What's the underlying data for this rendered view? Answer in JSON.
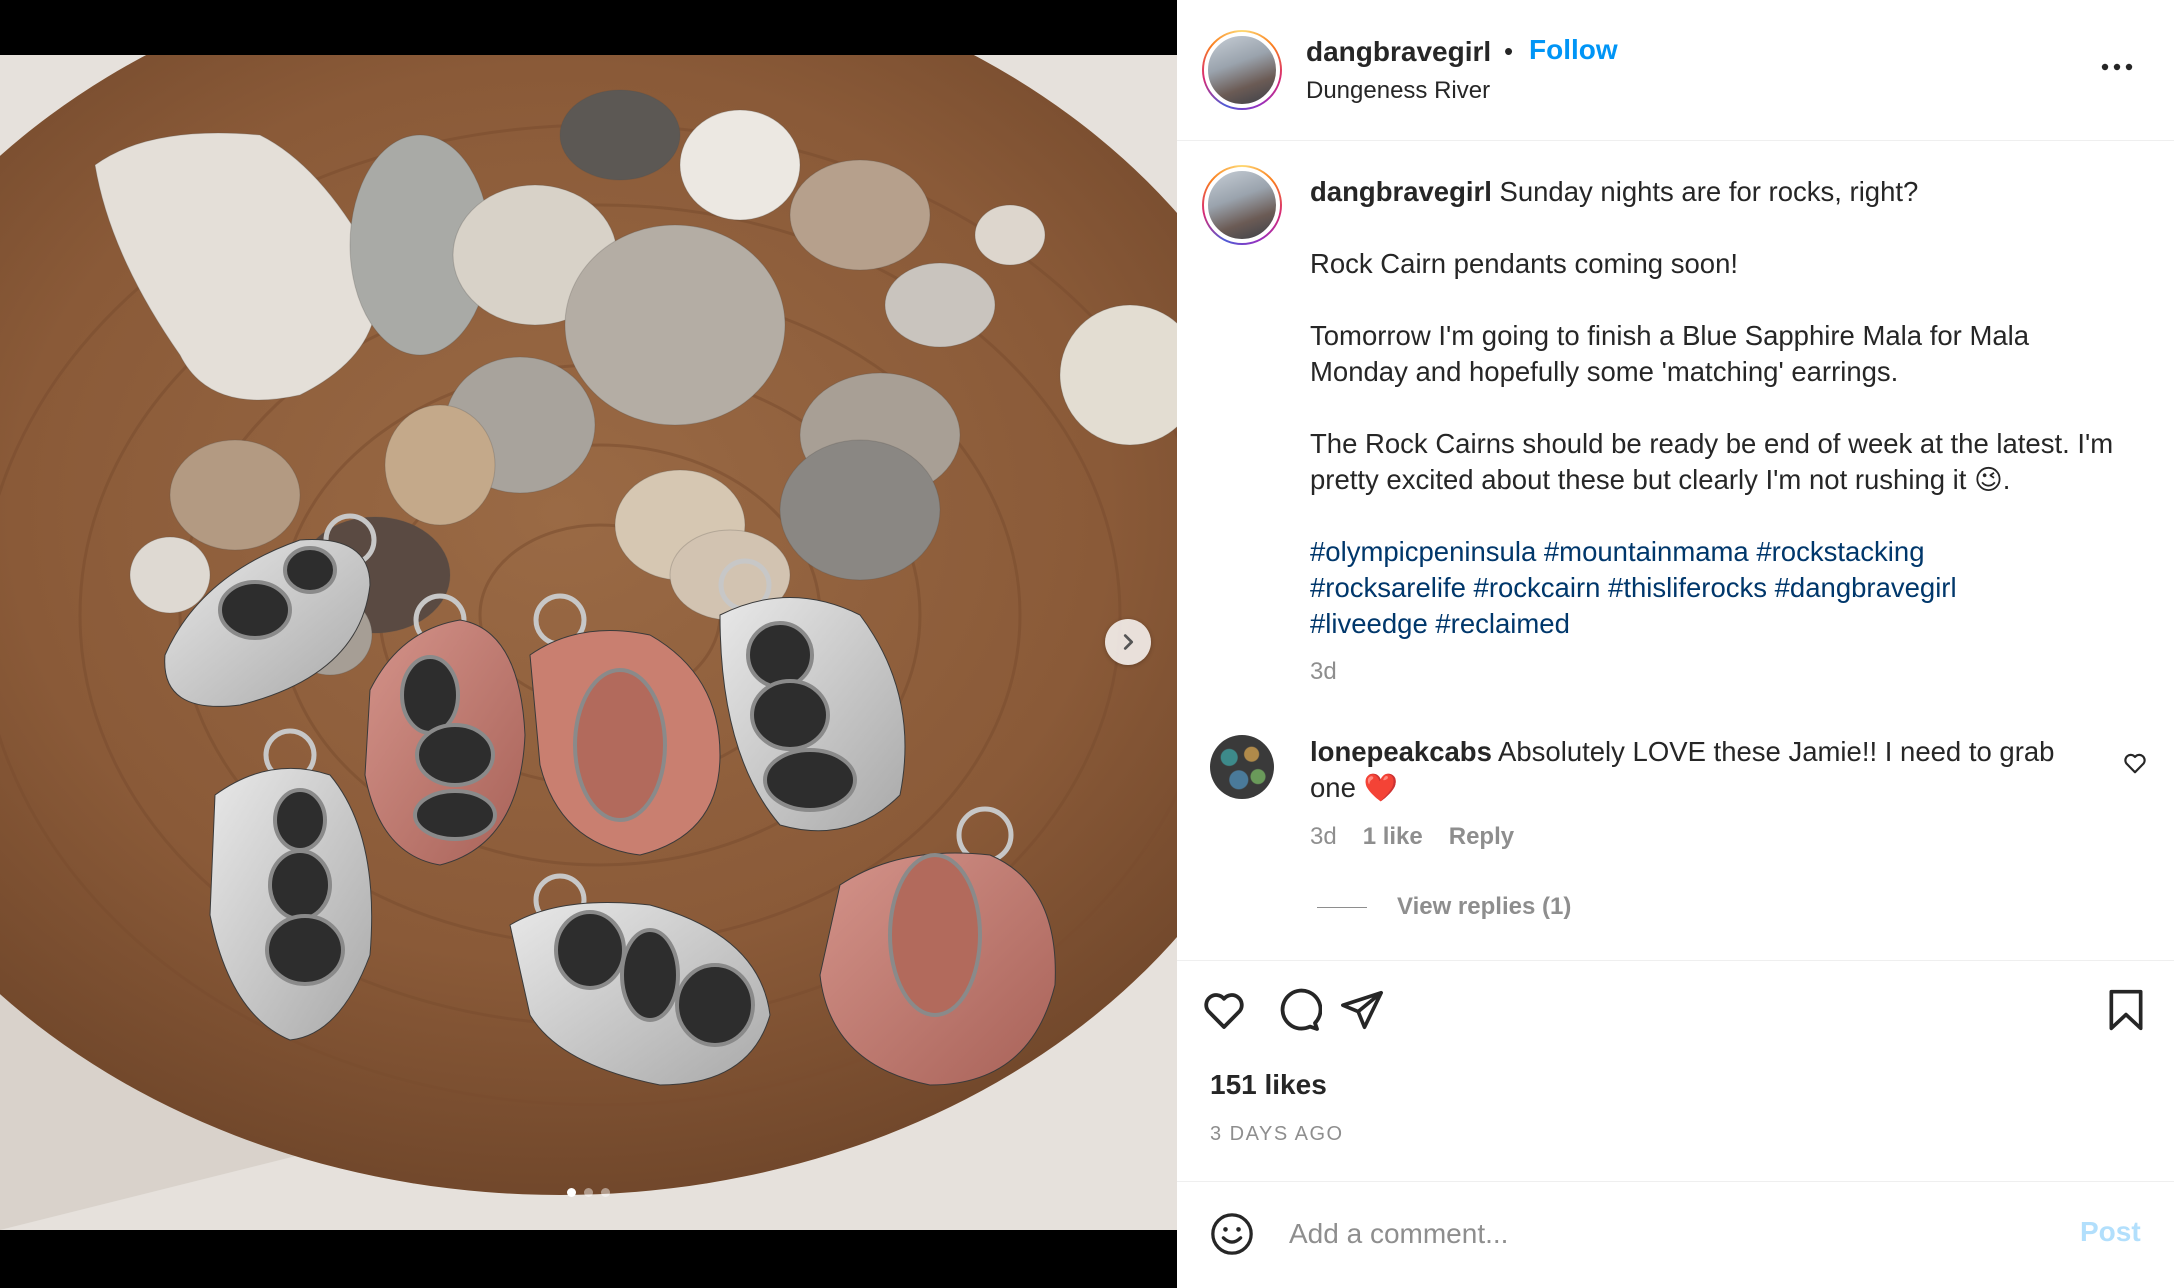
{
  "post": {
    "username": "dangbravegirl",
    "separator": "•",
    "follow_label": "Follow",
    "location": "Dungeness River",
    "image": {
      "carousel_dot_count": 3,
      "active_dot": 1
    },
    "caption": {
      "username": "dangbravegirl",
      "line1": "Sunday nights are for rocks, right?",
      "para2": "Rock Cairn pendants coming soon!",
      "para3": "Tomorrow I'm going to finish a Blue Sapphire Mala for Mala Monday and hopefully some 'matching' earrings.",
      "para4": "The Rock Cairns should be ready be end of week at the latest. I'm pretty excited about these but clearly I'm not rushing it 😉.",
      "hashtags": [
        "#olympicpeninsula",
        "#mountainmama",
        "#rockstacking",
        "#rocksarelife",
        "#rockcairn",
        "#thisliferocks",
        "#dangbravegirl",
        "#liveedge",
        "#reclaimed"
      ],
      "time": "3d"
    },
    "comments": [
      {
        "username": "lonepeakcabs",
        "text": "Absolutely LOVE these Jamie!! I need to grab one ❤️",
        "time": "3d",
        "likes": "1 like",
        "reply_label": "Reply",
        "view_replies": "View replies (1)"
      }
    ],
    "likes": "151 likes",
    "date": "3 DAYS AGO",
    "add_comment": {
      "placeholder": "Add a comment...",
      "post_label": "Post"
    }
  },
  "icons": {
    "more": "more-horizontal-icon",
    "next": "chevron-right-icon",
    "like": "heart-icon",
    "comment": "comment-bubble-icon",
    "share": "paper-plane-icon",
    "save": "bookmark-icon",
    "emoji": "smiley-icon"
  },
  "colors": {
    "accent": "#0095f6",
    "hashtag": "#00376b",
    "muted": "#8e8e8e",
    "post_disabled": "#b2dffc"
  }
}
